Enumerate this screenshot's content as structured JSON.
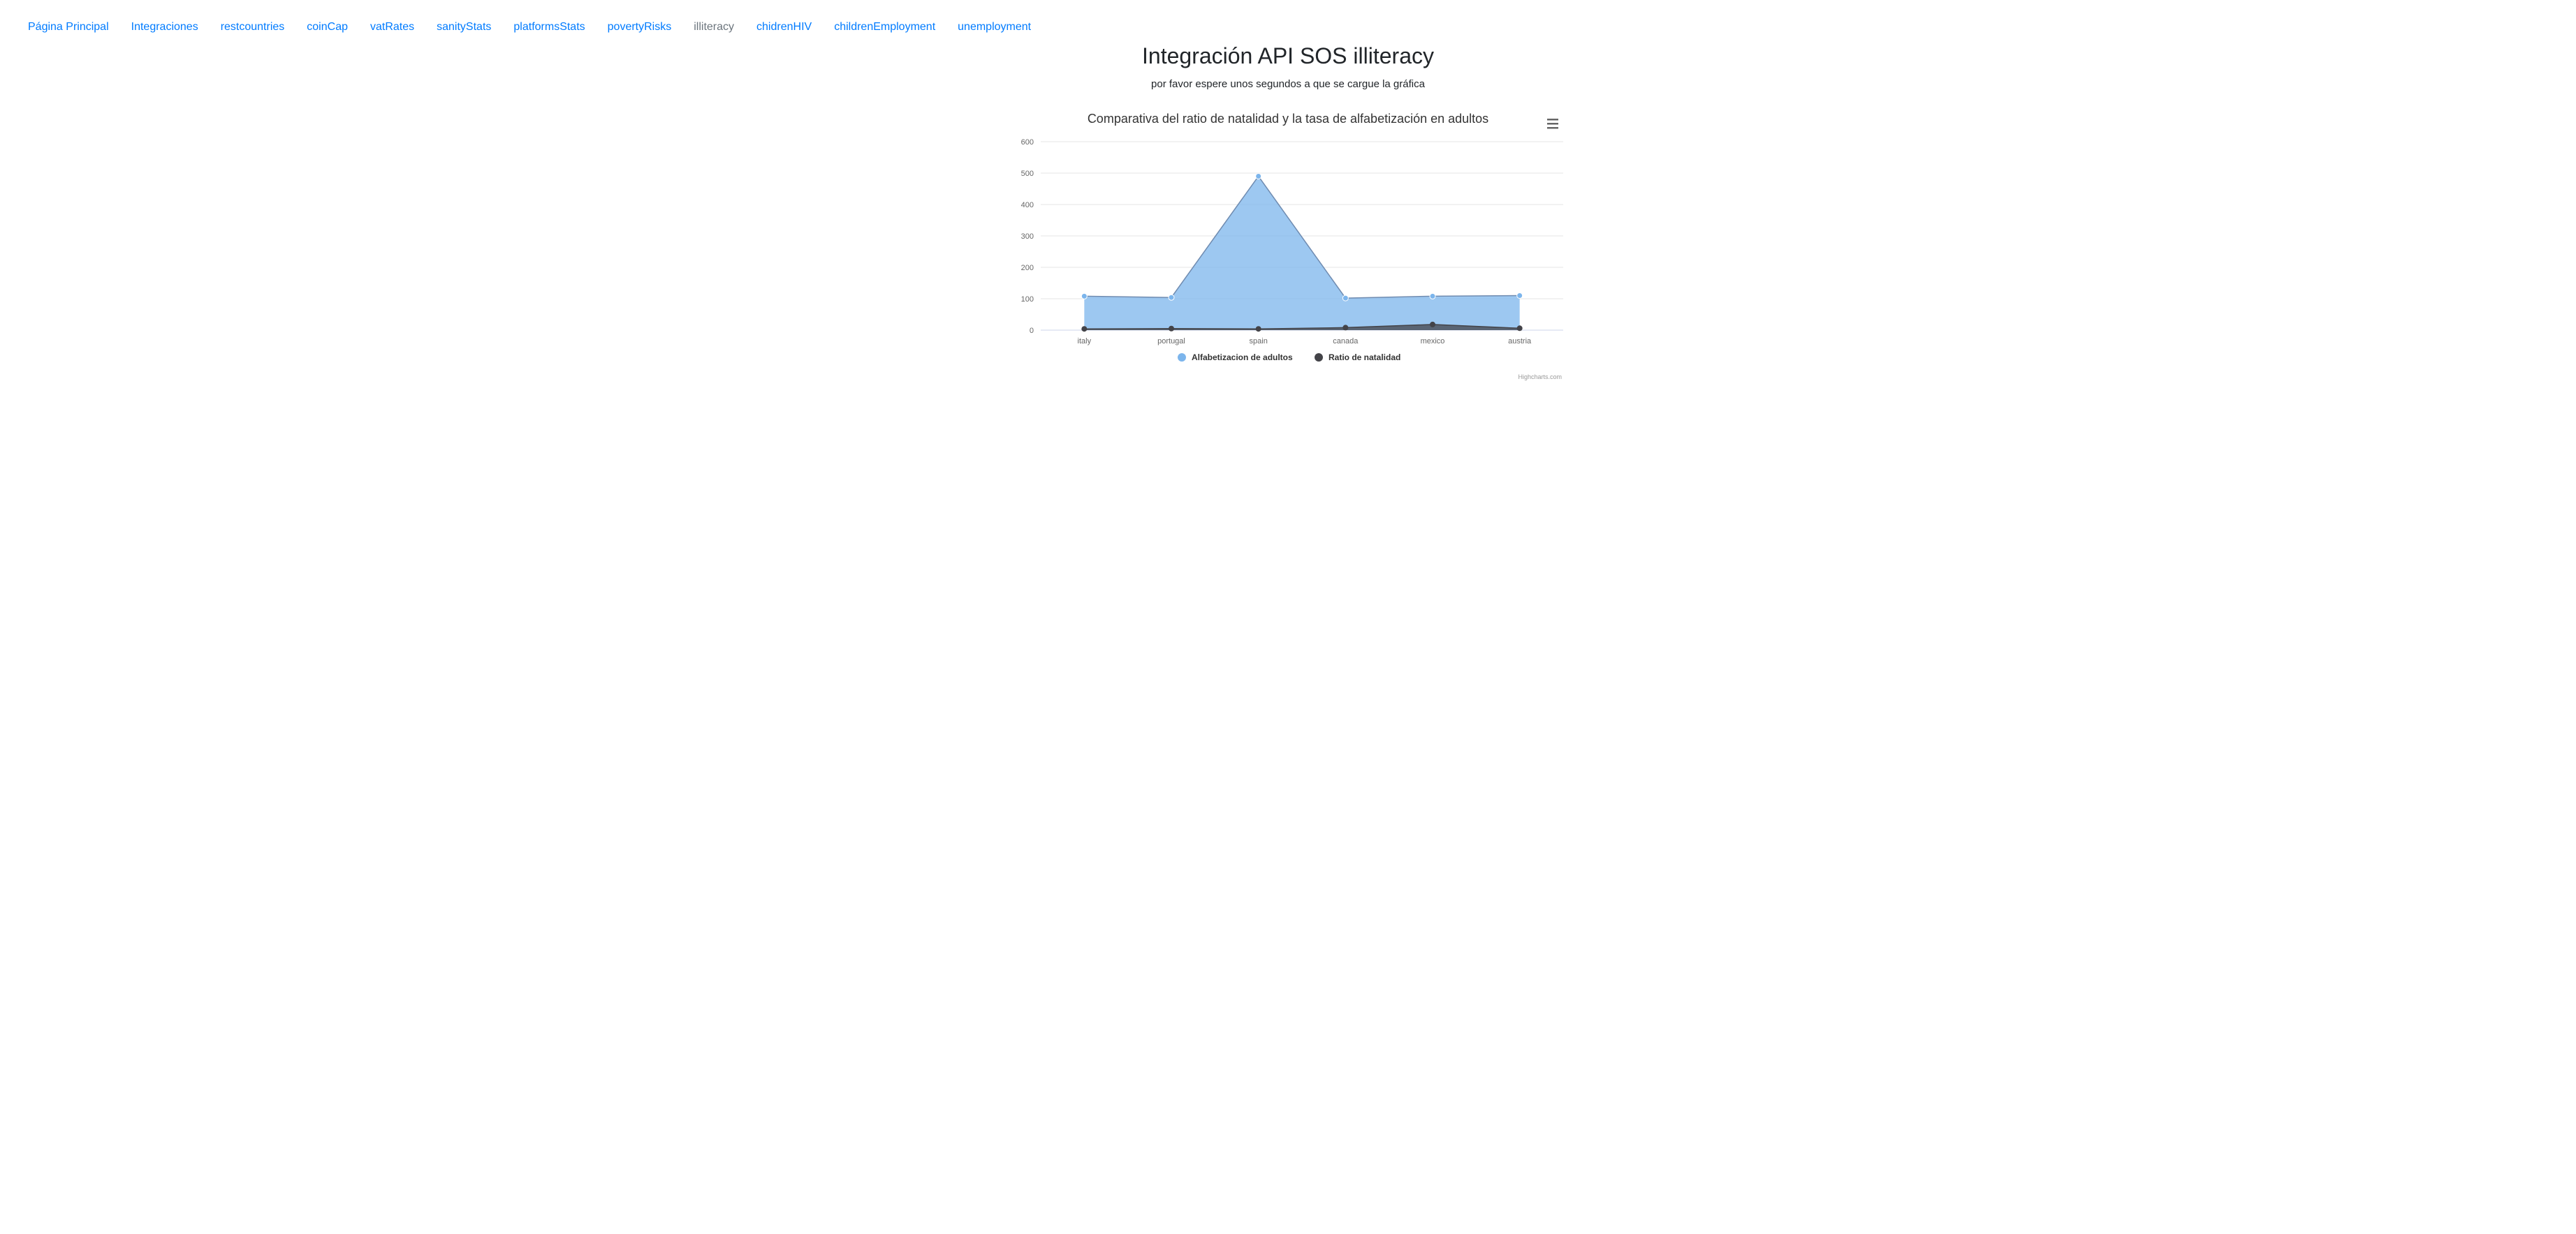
{
  "nav": {
    "items": [
      {
        "label": "Página Principal"
      },
      {
        "label": "Integraciones"
      },
      {
        "label": "restcountries"
      },
      {
        "label": "coinCap"
      },
      {
        "label": "vatRates"
      },
      {
        "label": "sanityStats"
      },
      {
        "label": "platformsStats"
      },
      {
        "label": "povertyRisks"
      },
      {
        "label": "illiteracy",
        "active": true
      },
      {
        "label": "chidrenHIV"
      },
      {
        "label": "childrenEmployment"
      },
      {
        "label": "unemployment"
      }
    ]
  },
  "page": {
    "title": "Integración API SOS illiteracy",
    "subtitle": "por favor espere unos segundos a que se cargue la gráfica"
  },
  "chart_data": {
    "type": "area",
    "title": "Comparativa del ratio de natalidad y la tasa de alfabetización en adultos",
    "credits": "Highcharts.com",
    "categories": [
      "italy",
      "portugal",
      "spain",
      "canada",
      "mexico",
      "austria"
    ],
    "ylim": [
      0,
      600
    ],
    "yticks": [
      0,
      100,
      200,
      300,
      400,
      500,
      600
    ],
    "grid": true,
    "legend_position": "bottom-center",
    "menu_icon": "hamburger-menu-icon",
    "series": [
      {
        "name": "Alfabetizacion de adultos",
        "values": [
          108,
          104,
          490,
          102,
          108,
          110
        ],
        "color": "#7cb5ec"
      },
      {
        "name": "Ratio de natalidad",
        "values": [
          4,
          5,
          4,
          8,
          18,
          6
        ],
        "color": "#434348"
      }
    ]
  }
}
